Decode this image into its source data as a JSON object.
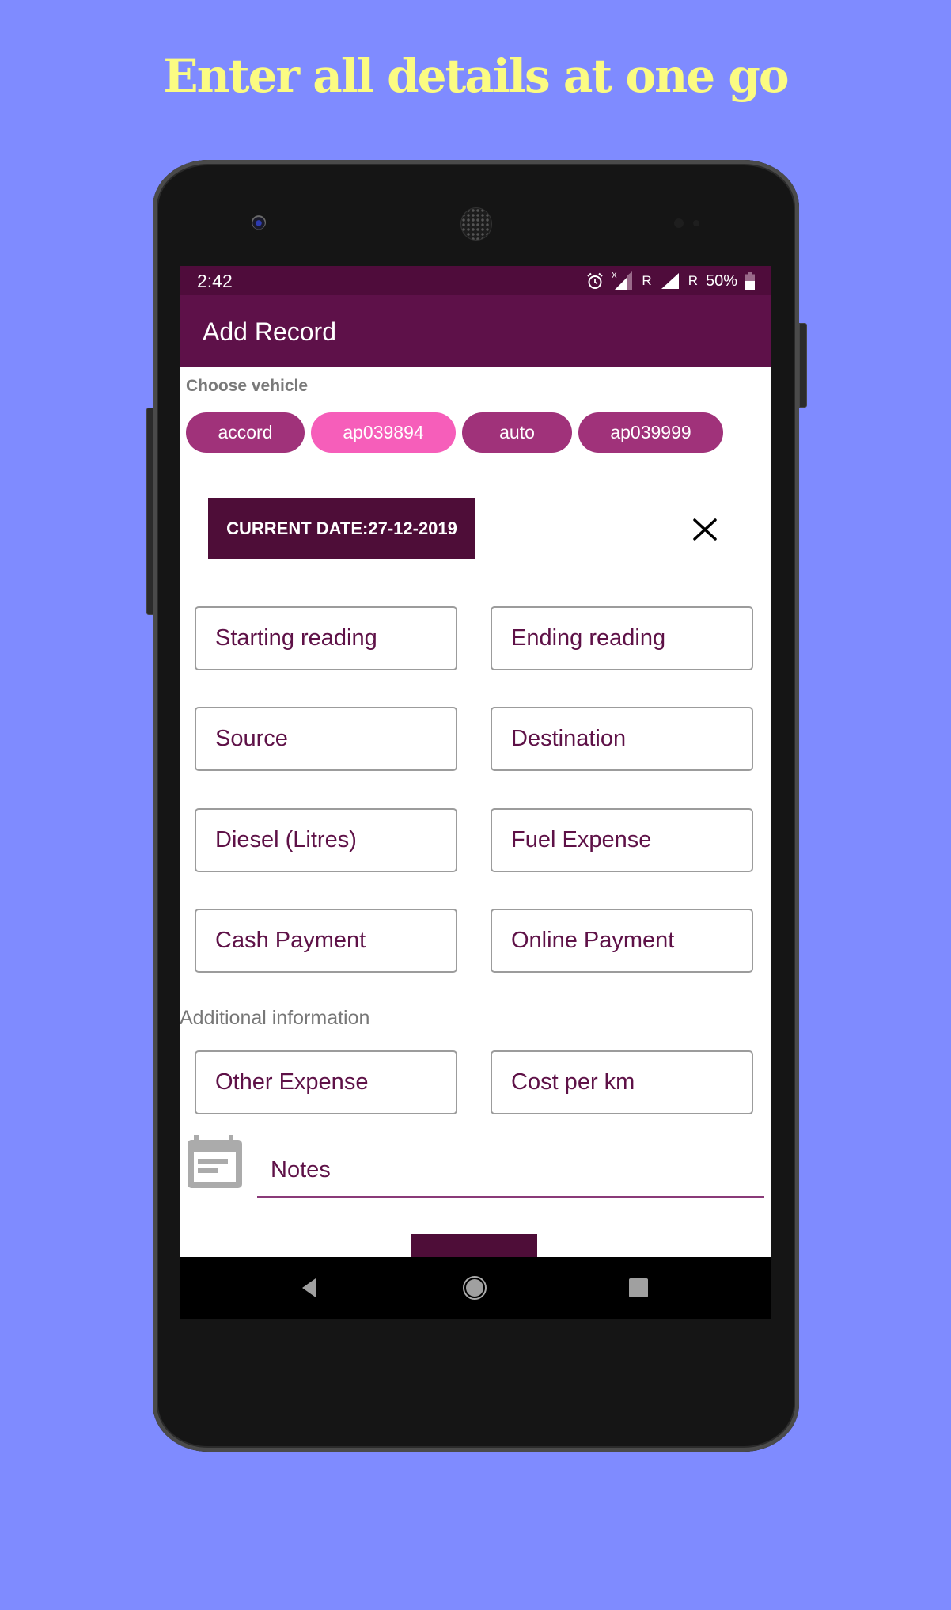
{
  "headline": "Enter all details at one go",
  "status_bar": {
    "time": "2:42",
    "icons": [
      "alarm-icon",
      "signal-x-icon",
      "signal-icon",
      "battery-icon"
    ],
    "roaming_1": "R",
    "roaming_2": "R",
    "battery": "50%"
  },
  "app_bar": {
    "title": "Add Record"
  },
  "vehicle": {
    "label": "Choose vehicle",
    "chips": [
      {
        "label": "accord",
        "selected": false
      },
      {
        "label": "ap039894",
        "selected": true
      },
      {
        "label": "auto",
        "selected": false
      },
      {
        "label": "ap039999",
        "selected": false
      }
    ]
  },
  "date_button": "CURRENT DATE:27-12-2019",
  "fields": {
    "starting_reading": "Starting reading",
    "ending_reading": "Ending reading",
    "source": "Source",
    "destination": "Destination",
    "diesel": "Diesel (Litres)",
    "fuel_expense": "Fuel Expense",
    "cash_payment": "Cash Payment",
    "online_payment": "Online Payment"
  },
  "additional": {
    "label": "Additional information",
    "other_expense": "Other Expense",
    "cost_per_km": "Cost per km",
    "notes_placeholder": "Notes"
  },
  "colors": {
    "background": "#7F8BFF",
    "headline": "#FBFB82",
    "status_bar": "#4F0C3B",
    "app_bar": "#5E1149",
    "chip": "#A0327A",
    "chip_selected": "#F65EBA",
    "button": "#4E0D38",
    "field_text": "#5E1147"
  }
}
